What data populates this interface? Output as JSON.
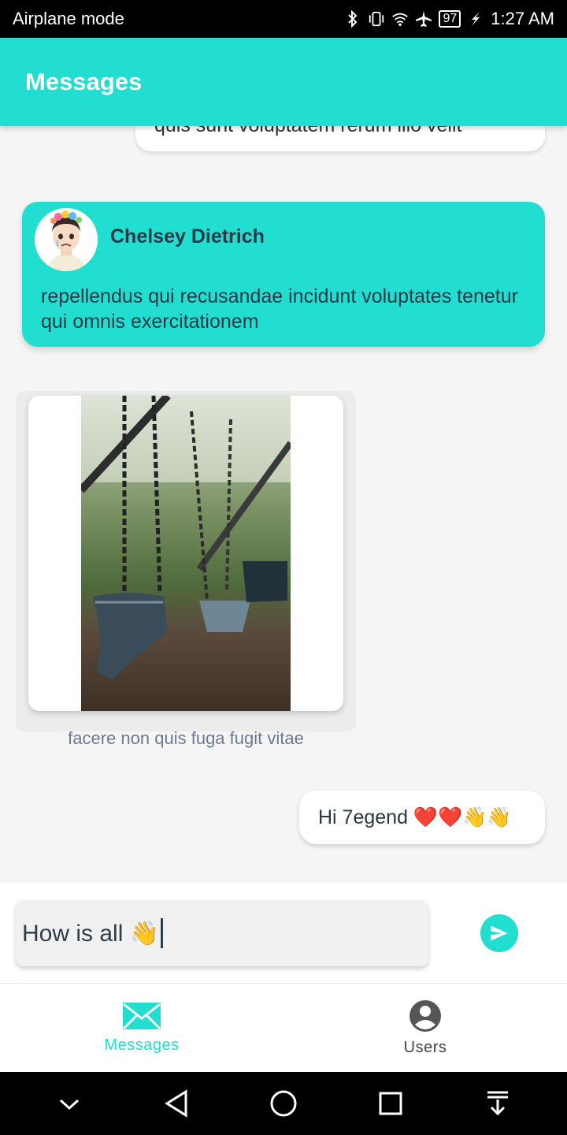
{
  "status_bar": {
    "left_text": "Airplane mode",
    "battery": "97",
    "time": "1:27 AM",
    "icons": [
      "bluetooth-icon",
      "vibrate-icon",
      "wifi-icon",
      "airplane-icon",
      "battery-icon",
      "saver-icon"
    ]
  },
  "app_bar": {
    "title": "Messages"
  },
  "messages": {
    "partial_text": "quis sunt voluptatem rerum illo velit",
    "card": {
      "sender": "Chelsey Dietrich",
      "text": "repellendus qui recusandae incidunt voluptates tenetur qui omnis exercitationem"
    },
    "image_caption": "facere non quis fuga fugit vitae",
    "sent_text": "Hi 7egend ❤️❤️👋👋"
  },
  "composer": {
    "value": "How is all 👋"
  },
  "bottom_nav": {
    "items": [
      {
        "label": "Messages",
        "icon": "mail-icon",
        "active": true
      },
      {
        "label": "Users",
        "icon": "account-circle-icon",
        "active": false
      }
    ]
  },
  "colors": {
    "accent": "#21ded1",
    "text_dark": "#283946",
    "caption": "#6b7a90"
  }
}
